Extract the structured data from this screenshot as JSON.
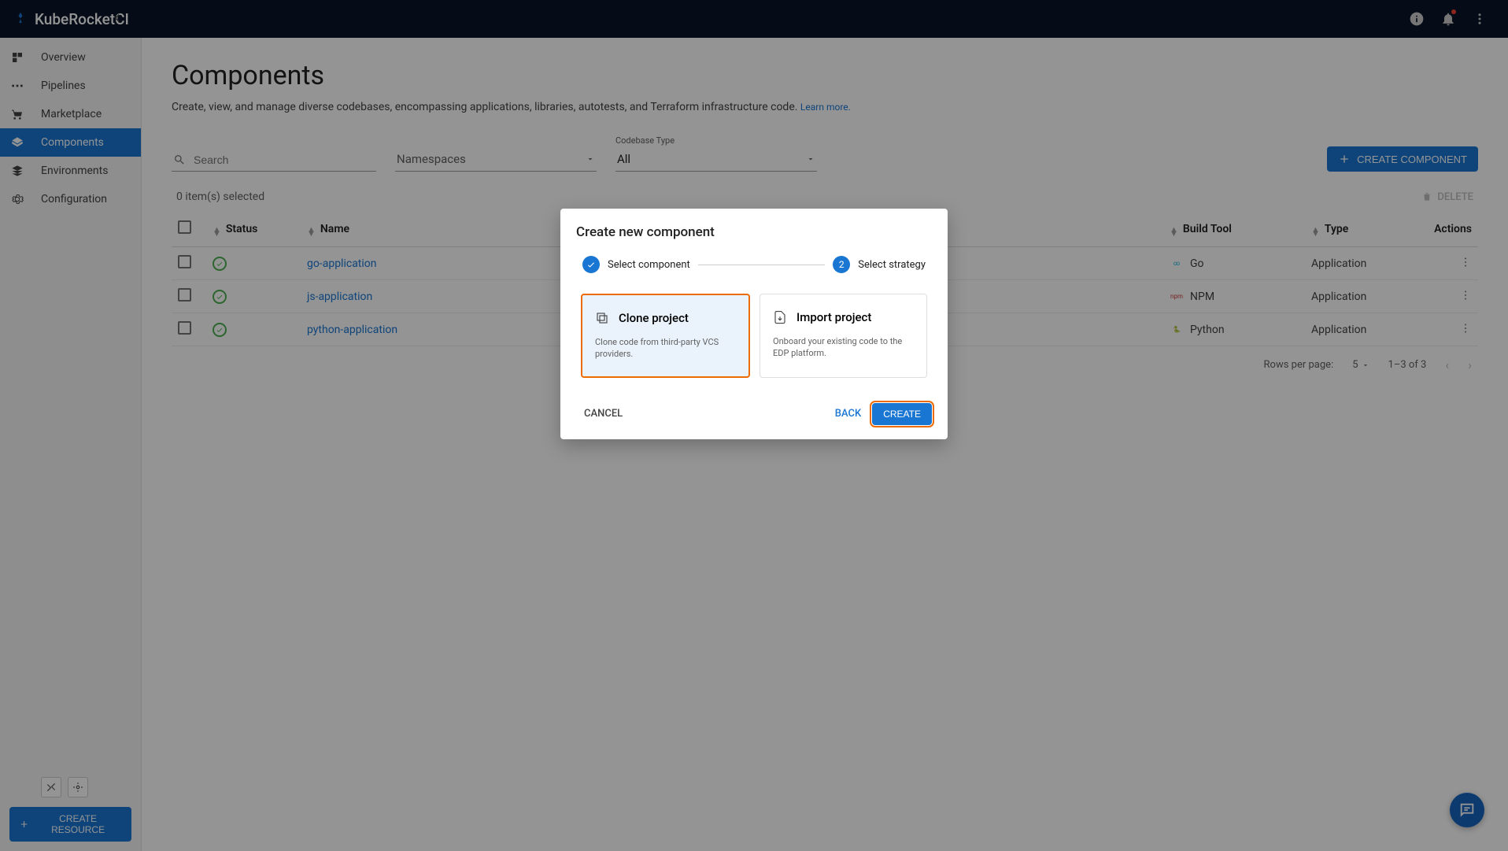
{
  "brand": "KubeRocketCI",
  "sidebar": {
    "items": [
      {
        "label": "Overview"
      },
      {
        "label": "Pipelines"
      },
      {
        "label": "Marketplace"
      },
      {
        "label": "Components"
      },
      {
        "label": "Environments"
      },
      {
        "label": "Configuration"
      }
    ],
    "createResource": "CREATE RESOURCE"
  },
  "page": {
    "title": "Components",
    "description": "Create, view, and manage diverse codebases, encompassing applications, libraries, autotests, and Terraform infrastructure code.",
    "learnMore": "Learn more."
  },
  "filters": {
    "searchPlaceholder": "Search",
    "namespacesLabel": "Namespaces",
    "codebaseTypeLabel": "Codebase Type",
    "codebaseTypeValue": "All",
    "createComponent": "CREATE COMPONENT"
  },
  "selection": {
    "text": "0 item(s) selected",
    "delete": "DELETE"
  },
  "table": {
    "headers": {
      "status": "Status",
      "name": "Name",
      "buildTool": "Build Tool",
      "type": "Type",
      "actions": "Actions"
    },
    "rows": [
      {
        "name": "go-application",
        "buildTool": "Go",
        "type": "Application",
        "langColor": "#00ADD8",
        "badge": "∞"
      },
      {
        "name": "js-application",
        "buildTool": "NPM",
        "type": "Application",
        "langColor": "#cb3837",
        "badge": "npm"
      },
      {
        "name": "python-application",
        "buildTool": "Python",
        "type": "Application",
        "langColor": "#3776ab",
        "badge": "🐍"
      }
    ]
  },
  "pagination": {
    "rowsPerPageLabel": "Rows per page:",
    "rowsPerPage": "5",
    "range": "1–3 of 3"
  },
  "dialog": {
    "title": "Create new component",
    "step1": "Select component",
    "step2num": "2",
    "step2": "Select strategy",
    "clone": {
      "title": "Clone project",
      "desc": "Clone code from third-party VCS providers."
    },
    "import": {
      "title": "Import project",
      "desc": "Onboard your existing code to the EDP platform."
    },
    "cancel": "CANCEL",
    "back": "BACK",
    "create": "CREATE"
  }
}
